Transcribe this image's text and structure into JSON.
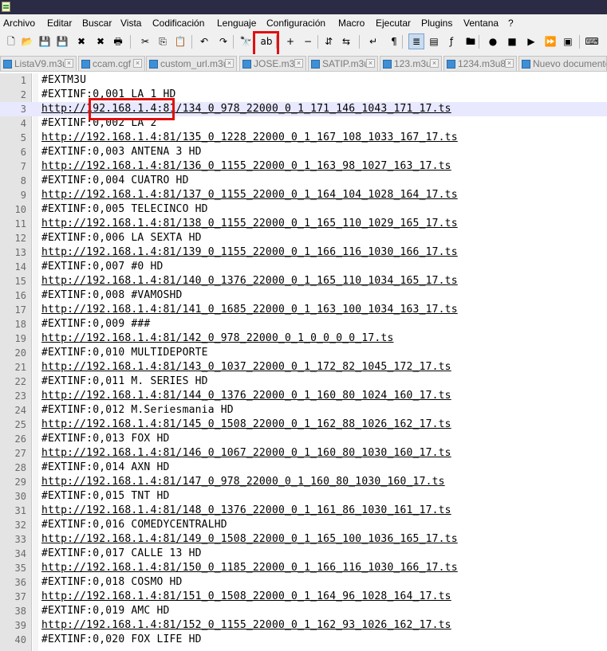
{
  "menubar": {
    "items": [
      "Archivo",
      "Editar",
      "Buscar",
      "Vista",
      "Codificación",
      "Lenguaje",
      "Configuración",
      "Macro",
      "Ejecutar",
      "Plugins",
      "Ventana",
      "?"
    ]
  },
  "toolbar": {
    "buttons": [
      {
        "name": "new-file-icon",
        "glyph": "🗋"
      },
      {
        "name": "open-file-icon",
        "glyph": "📂"
      },
      {
        "name": "save-icon",
        "glyph": "💾"
      },
      {
        "name": "save-all-icon",
        "glyph": "💾"
      },
      {
        "name": "close-icon",
        "glyph": "✖"
      },
      {
        "name": "close-all-icon",
        "glyph": "✖"
      },
      {
        "name": "print-icon",
        "glyph": "🖶"
      },
      {
        "name": "cut-icon",
        "glyph": "✂"
      },
      {
        "name": "copy-icon",
        "glyph": "⎘"
      },
      {
        "name": "paste-icon",
        "glyph": "📋"
      },
      {
        "name": "undo-icon",
        "glyph": "↶"
      },
      {
        "name": "redo-icon",
        "glyph": "↷"
      },
      {
        "name": "find-icon",
        "glyph": "🔭"
      },
      {
        "name": "replace-icon",
        "glyph": "ab"
      },
      {
        "name": "zoom-in-icon",
        "glyph": "+"
      },
      {
        "name": "zoom-out-icon",
        "glyph": "−"
      },
      {
        "name": "sync-vertical-icon",
        "glyph": "⇵"
      },
      {
        "name": "sync-horizontal-icon",
        "glyph": "⇆"
      },
      {
        "name": "word-wrap-icon",
        "glyph": "↵"
      },
      {
        "name": "show-all-characters-icon",
        "glyph": "¶"
      },
      {
        "name": "indent-guide-icon",
        "glyph": "≣"
      },
      {
        "name": "document-map-icon",
        "glyph": "▤"
      },
      {
        "name": "function-list-icon",
        "glyph": "ƒ"
      },
      {
        "name": "folder-as-workspace-icon",
        "glyph": "🖿"
      },
      {
        "name": "record-macro-icon",
        "glyph": "●"
      },
      {
        "name": "stop-recording-icon",
        "glyph": "■"
      },
      {
        "name": "playback-macro-icon",
        "glyph": "▶"
      },
      {
        "name": "run-macro-multiple-icon",
        "glyph": "⏩"
      },
      {
        "name": "save-macro-icon",
        "glyph": "▣"
      },
      {
        "name": "spell-check-icon",
        "glyph": "⌨"
      }
    ]
  },
  "tabs": [
    {
      "label": "ListaV9.m3u"
    },
    {
      "label": "ccam.cgf"
    },
    {
      "label": "custom_url.m3u"
    },
    {
      "label": "JOSE.m3u"
    },
    {
      "label": "SATIP.m3u"
    },
    {
      "label": "123.m3u"
    },
    {
      "label": "1234.m3u8"
    },
    {
      "label": "Nuevo documento"
    }
  ],
  "editor": {
    "current_line": 3,
    "lines": [
      {
        "n": "1",
        "text": "#EXTM3U",
        "url": false
      },
      {
        "n": "2",
        "text": "#EXTINF:0,001 LA 1 HD",
        "url": false
      },
      {
        "n": "3",
        "text": "http://192.168.1.4:81/134_0_978_22000_0_1_171_146_1043_171_17.ts",
        "url": true
      },
      {
        "n": "4",
        "text": "#EXTINF:0,002 LA 2",
        "url": false
      },
      {
        "n": "5",
        "text": "http://192.168.1.4:81/135_0_1228_22000_0_1_167_108_1033_167_17.ts",
        "url": true
      },
      {
        "n": "6",
        "text": "#EXTINF:0,003 ANTENA 3 HD",
        "url": false
      },
      {
        "n": "7",
        "text": "http://192.168.1.4:81/136_0_1155_22000_0_1_163_98_1027_163_17.ts",
        "url": true
      },
      {
        "n": "8",
        "text": "#EXTINF:0,004 CUATRO HD",
        "url": false
      },
      {
        "n": "9",
        "text": "http://192.168.1.4:81/137_0_1155_22000_0_1_164_104_1028_164_17.ts",
        "url": true
      },
      {
        "n": "10",
        "text": "#EXTINF:0,005 TELECINCO HD",
        "url": false
      },
      {
        "n": "11",
        "text": "http://192.168.1.4:81/138_0_1155_22000_0_1_165_110_1029_165_17.ts",
        "url": true
      },
      {
        "n": "12",
        "text": "#EXTINF:0,006 LA SEXTA HD",
        "url": false
      },
      {
        "n": "13",
        "text": "http://192.168.1.4:81/139_0_1155_22000_0_1_166_116_1030_166_17.ts",
        "url": true
      },
      {
        "n": "14",
        "text": "#EXTINF:0,007 #0 HD",
        "url": false
      },
      {
        "n": "15",
        "text": "http://192.168.1.4:81/140_0_1376_22000_0_1_165_110_1034_165_17.ts",
        "url": true
      },
      {
        "n": "16",
        "text": "#EXTINF:0,008 #VAMOSHD",
        "url": false
      },
      {
        "n": "17",
        "text": "http://192.168.1.4:81/141_0_1685_22000_0_1_163_100_1034_163_17.ts",
        "url": true
      },
      {
        "n": "18",
        "text": "#EXTINF:0,009 ###",
        "url": false
      },
      {
        "n": "19",
        "text": "http://192.168.1.4:81/142_0_978_22000_0_1_0_0_0_0_17.ts",
        "url": true
      },
      {
        "n": "20",
        "text": "#EXTINF:0,010 MULTIDEPORTE",
        "url": false
      },
      {
        "n": "21",
        "text": "http://192.168.1.4:81/143_0_1037_22000_0_1_172_82_1045_172_17.ts",
        "url": true
      },
      {
        "n": "22",
        "text": "#EXTINF:0,011 M. SERIES HD",
        "url": false
      },
      {
        "n": "23",
        "text": "http://192.168.1.4:81/144_0_1376_22000_0_1_160_80_1024_160_17.ts",
        "url": true
      },
      {
        "n": "24",
        "text": "#EXTINF:0,012 M.Seriesmania HD",
        "url": false
      },
      {
        "n": "25",
        "text": "http://192.168.1.4:81/145_0_1508_22000_0_1_162_88_1026_162_17.ts",
        "url": true
      },
      {
        "n": "26",
        "text": "#EXTINF:0,013 FOX HD",
        "url": false
      },
      {
        "n": "27",
        "text": "http://192.168.1.4:81/146_0_1067_22000_0_1_160_80_1030_160_17.ts",
        "url": true
      },
      {
        "n": "28",
        "text": "#EXTINF:0,014 AXN HD",
        "url": false
      },
      {
        "n": "29",
        "text": "http://192.168.1.4:81/147_0_978_22000_0_1_160_80_1030_160_17.ts",
        "url": true
      },
      {
        "n": "30",
        "text": "#EXTINF:0,015 TNT HD",
        "url": false
      },
      {
        "n": "31",
        "text": "http://192.168.1.4:81/148_0_1376_22000_0_1_161_86_1030_161_17.ts",
        "url": true
      },
      {
        "n": "32",
        "text": "#EXTINF:0,016 COMEDYCENTRALHD",
        "url": false
      },
      {
        "n": "33",
        "text": "http://192.168.1.4:81/149_0_1508_22000_0_1_165_100_1036_165_17.ts",
        "url": true
      },
      {
        "n": "34",
        "text": "#EXTINF:0,017 CALLE 13 HD",
        "url": false
      },
      {
        "n": "35",
        "text": "http://192.168.1.4:81/150_0_1185_22000_0_1_166_116_1030_166_17.ts",
        "url": true
      },
      {
        "n": "36",
        "text": "#EXTINF:0,018 COSMO HD",
        "url": false
      },
      {
        "n": "37",
        "text": "http://192.168.1.4:81/151_0_1508_22000_0_1_164_96_1028_164_17.ts",
        "url": true
      },
      {
        "n": "38",
        "text": "#EXTINF:0,019 AMC HD",
        "url": false
      },
      {
        "n": "39",
        "text": "http://192.168.1.4:81/152_0_1155_22000_0_1_162_93_1026_162_17.ts",
        "url": true
      },
      {
        "n": "40",
        "text": "#EXTINF:0,020 FOX LIFE HD",
        "url": false
      }
    ]
  }
}
